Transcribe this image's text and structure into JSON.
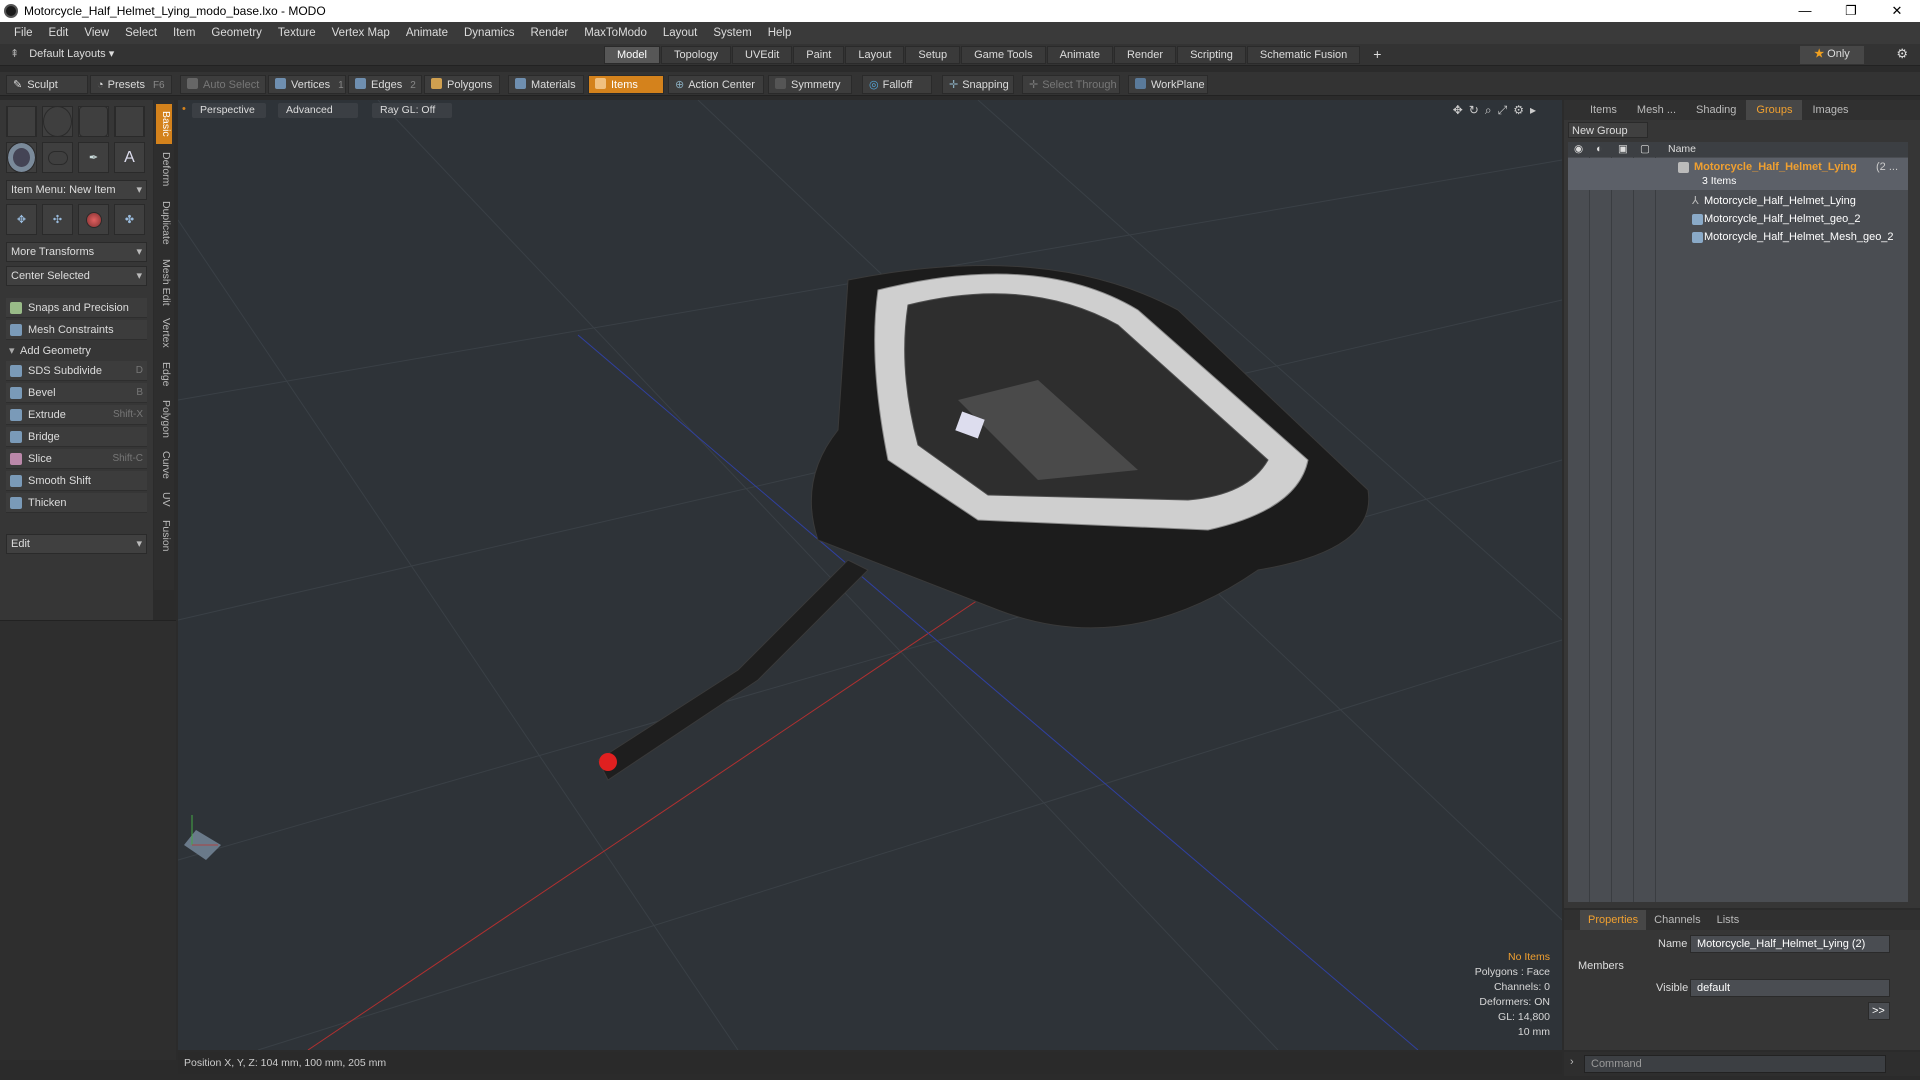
{
  "window": {
    "title": "Motorcycle_Half_Helmet_Lying_modo_base.lxo - MODO",
    "min": "—",
    "restore": "❐",
    "close": "✕"
  },
  "menu": [
    "File",
    "Edit",
    "View",
    "Select",
    "Item",
    "Geometry",
    "Texture",
    "Vertex Map",
    "Animate",
    "Dynamics",
    "Render",
    "MaxToModo",
    "Layout",
    "System",
    "Help"
  ],
  "layoutbar": {
    "layout_select": "Default Layouts ▾",
    "tabs": [
      "Model",
      "Topology",
      "UVEdit",
      "Paint",
      "Layout",
      "Setup",
      "Game Tools",
      "Animate",
      "Render",
      "Scripting",
      "Schematic Fusion"
    ],
    "active_tab": "Model",
    "add": "+",
    "only": "Only",
    "only_star": "★"
  },
  "toolbar": {
    "sculpt": "Sculpt",
    "presets": "Presets",
    "presets_key": "F6",
    "auto_select": "Auto Select",
    "vertices": "Vertices",
    "vertices_count": "1",
    "edges": "Edges",
    "edges_count": "2",
    "polygons": "Polygons",
    "materials": "Materials",
    "items": "Items",
    "action_center": "Action Center",
    "symmetry": "Symmetry",
    "falloff": "Falloff",
    "snapping": "Snapping",
    "select_through": "Select Through",
    "workplane": "WorkPlane"
  },
  "left_panel": {
    "item_menu": "Item Menu: New Item",
    "more_transforms": "More Transforms",
    "center_selected": "Center Selected",
    "snaps": "Snaps and Precision",
    "mesh_constraints": "Mesh Constraints",
    "add_geometry": "Add Geometry",
    "tools": [
      {
        "label": "SDS Subdivide",
        "key": "D"
      },
      {
        "label": "Bevel",
        "key": "B"
      },
      {
        "label": "Extrude",
        "key": "Shift-X"
      },
      {
        "label": "Bridge",
        "key": ""
      },
      {
        "label": "Slice",
        "key": "Shift-C"
      },
      {
        "label": "Smooth Shift",
        "key": ""
      },
      {
        "label": "Thicken",
        "key": ""
      }
    ],
    "edit": "Edit",
    "vtabs": [
      "Basic",
      "Deform",
      "Duplicate",
      "Mesh Edit",
      "Vertex",
      "Edge",
      "Polygon",
      "Curve",
      "UV",
      "Fusion"
    ]
  },
  "viewport": {
    "perspective": "Perspective",
    "advanced": "Advanced",
    "raygl": "Ray GL: Off",
    "stats": {
      "no_items": "No Items",
      "polygons": "Polygons : Face",
      "channels": "Channels: 0",
      "deformers": "Deformers: ON",
      "gl": "GL: 14,800",
      "scale": "10 mm"
    }
  },
  "status": {
    "position": "Position X, Y, Z:  104 mm, 100 mm, 205 mm"
  },
  "right_panel": {
    "tabs": [
      "Items",
      "Mesh ...",
      "Shading",
      "Groups",
      "Images"
    ],
    "active_tab": "Groups",
    "new_group": "New Group",
    "col_name": "Name",
    "group_name": "Motorcycle_Half_Helmet_Lying",
    "group_suffix": "(2 ...",
    "group_count": "3 Items",
    "members": [
      "Motorcycle_Half_Helmet_Lying",
      "Motorcycle_Half_Helmet_geo_2",
      "Motorcycle_Half_Helmet_Mesh_geo_2"
    ]
  },
  "properties": {
    "tabs": [
      "Properties",
      "Channels",
      "Lists"
    ],
    "active_tab": "Properties",
    "name_label": "Name",
    "name_value": "Motorcycle_Half_Helmet_Lying (2)",
    "members_label": "Members",
    "visible_label": "Visible",
    "visible_value": "default",
    "more": ">>"
  },
  "command": {
    "placeholder": "Command"
  },
  "colors": {
    "accent": "#d4821c",
    "viewport": "#2e3338"
  }
}
